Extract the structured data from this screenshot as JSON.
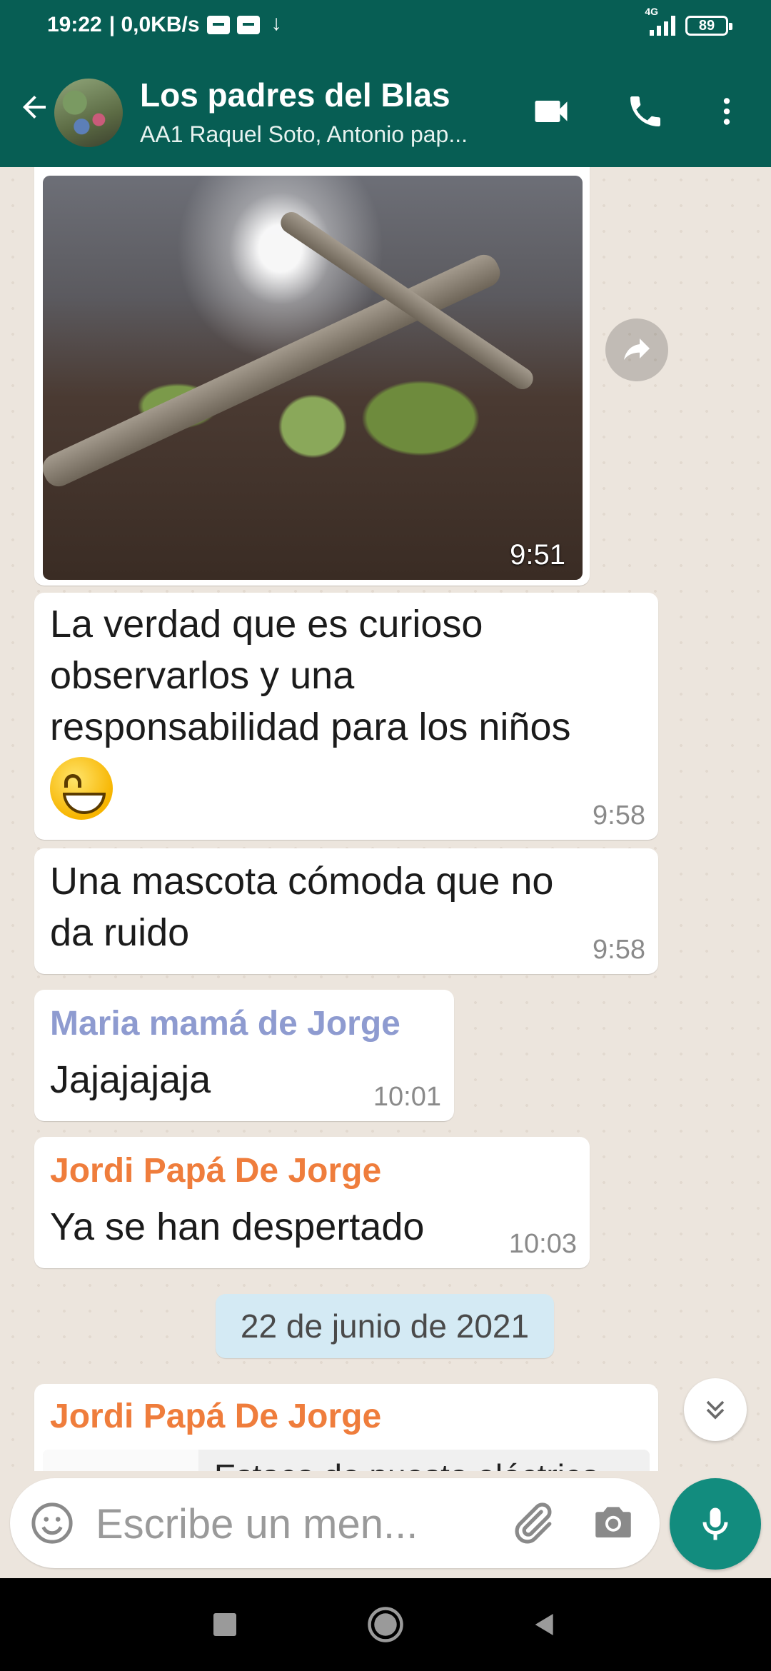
{
  "status_bar": {
    "time": "19:22",
    "speed": "| 0,0KB/s",
    "network": "4G",
    "battery": "89"
  },
  "header": {
    "title": "Los padres del Blas",
    "subtitle": "AA1 Raquel Soto, Antonio pap..."
  },
  "messages": [
    {
      "type": "image",
      "time": "9:51"
    },
    {
      "type": "text",
      "text_lines": [
        "La verdad que es curioso",
        "observarlos y una",
        "responsabilidad para los niños"
      ],
      "emoji": "grinning-face",
      "time": "9:58"
    },
    {
      "type": "text",
      "text_lines": [
        "Una mascota cómoda que no",
        "da ruido"
      ],
      "time": "9:58"
    },
    {
      "type": "text",
      "sender": "Maria mamá de Jorge",
      "sender_color": "#8e9bd0",
      "text": "Jajajajaja",
      "time": "10:01"
    },
    {
      "type": "text",
      "sender": "Jordi Papá De Jorge",
      "sender_color": "#ef7d3c",
      "text": "Ya se han despertado",
      "time": "10:03"
    }
  ],
  "date_separator": "22 de junio de 2021",
  "last_message": {
    "sender": "Jordi Papá De Jorge",
    "sender_color": "#ef7d3c",
    "preview_text": "Estaco de puesto eléctrico"
  },
  "input": {
    "placeholder": "Escribe un men..."
  },
  "colors": {
    "header": "#075e54",
    "accent": "#128c7e",
    "chat_bg": "#ece5dd",
    "date_chip": "#d4eaf4"
  }
}
